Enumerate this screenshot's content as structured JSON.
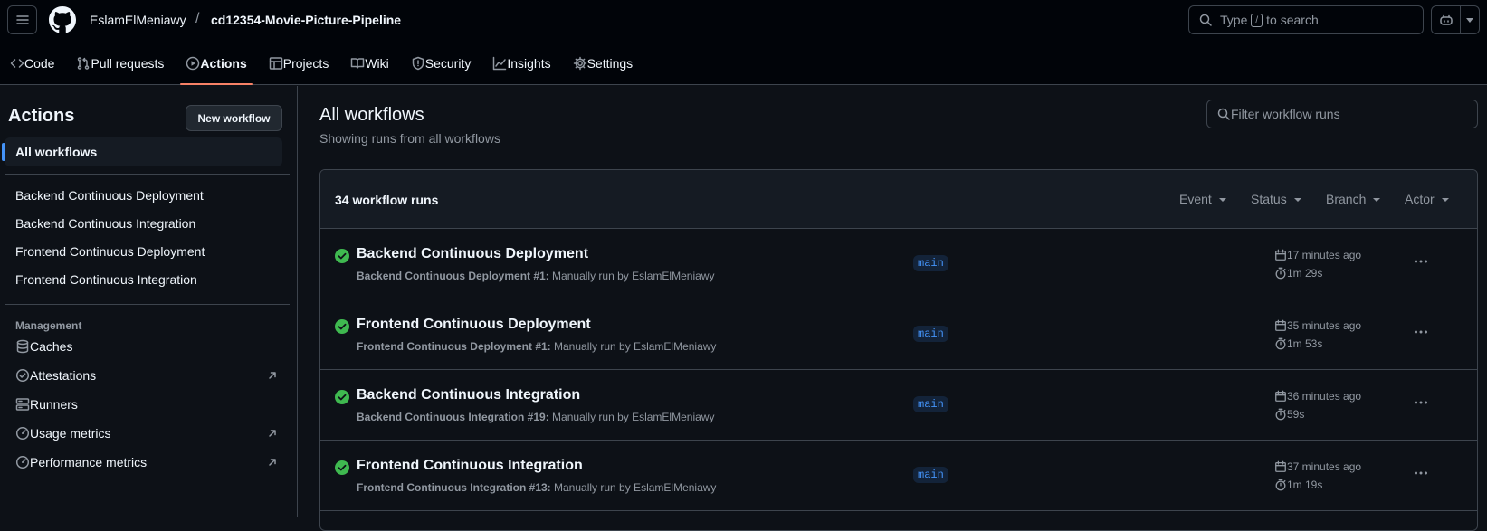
{
  "header": {
    "owner": "EslamElMeniawy",
    "separator": "/",
    "repo": "cd12354-Movie-Picture-Pipeline",
    "search_prefix": "Type",
    "search_key": "/",
    "search_suffix": "to search"
  },
  "tabs": [
    {
      "label": "Code",
      "icon": "code-icon"
    },
    {
      "label": "Pull requests",
      "icon": "git-pull-request-icon"
    },
    {
      "label": "Actions",
      "icon": "play-icon",
      "active": true
    },
    {
      "label": "Projects",
      "icon": "table-icon"
    },
    {
      "label": "Wiki",
      "icon": "book-icon"
    },
    {
      "label": "Security",
      "icon": "shield-icon"
    },
    {
      "label": "Insights",
      "icon": "graph-icon"
    },
    {
      "label": "Settings",
      "icon": "gear-icon"
    }
  ],
  "sidebar": {
    "title": "Actions",
    "new_workflow": "New workflow",
    "all_workflows": "All workflows",
    "workflows": [
      "Backend Continuous Deployment",
      "Backend Continuous Integration",
      "Frontend Continuous Deployment",
      "Frontend Continuous Integration"
    ],
    "management_heading": "Management",
    "management": [
      {
        "label": "Caches",
        "icon": "database-icon"
      },
      {
        "label": "Attestations",
        "icon": "verified-icon",
        "external": true
      },
      {
        "label": "Runners",
        "icon": "server-icon"
      },
      {
        "label": "Usage metrics",
        "icon": "meter-icon",
        "external": true
      },
      {
        "label": "Performance metrics",
        "icon": "meter-icon",
        "external": true
      }
    ]
  },
  "main": {
    "title": "All workflows",
    "subtitle": "Showing runs from all workflows",
    "filter_placeholder": "Filter workflow runs",
    "runs_count": "34 workflow runs",
    "filters": [
      "Event",
      "Status",
      "Branch",
      "Actor"
    ],
    "runs": [
      {
        "title": "Backend Continuous Deployment",
        "workflow": "Backend Continuous Deployment #1:",
        "desc": "Manually run by EslamElMeniawy",
        "branch": "main",
        "when": "17 minutes ago",
        "duration": "1m 29s",
        "status": "success"
      },
      {
        "title": "Frontend Continuous Deployment",
        "workflow": "Frontend Continuous Deployment #1:",
        "desc": "Manually run by EslamElMeniawy",
        "branch": "main",
        "when": "35 minutes ago",
        "duration": "1m 53s",
        "status": "success"
      },
      {
        "title": "Backend Continuous Integration",
        "workflow": "Backend Continuous Integration #19:",
        "desc": "Manually run by EslamElMeniawy",
        "branch": "main",
        "when": "36 minutes ago",
        "duration": "59s",
        "status": "success"
      },
      {
        "title": "Frontend Continuous Integration",
        "workflow": "Frontend Continuous Integration #13:",
        "desc": "Manually run by EslamElMeniawy",
        "branch": "main",
        "when": "37 minutes ago",
        "duration": "1m 19s",
        "status": "success"
      }
    ]
  },
  "colors": {
    "background": "#0d1117",
    "header_bg": "#010409",
    "border": "#3d444d",
    "accent_underline": "#f78166",
    "success": "#3fb950",
    "link_blue": "#4493f8",
    "muted": "#9198a1"
  }
}
